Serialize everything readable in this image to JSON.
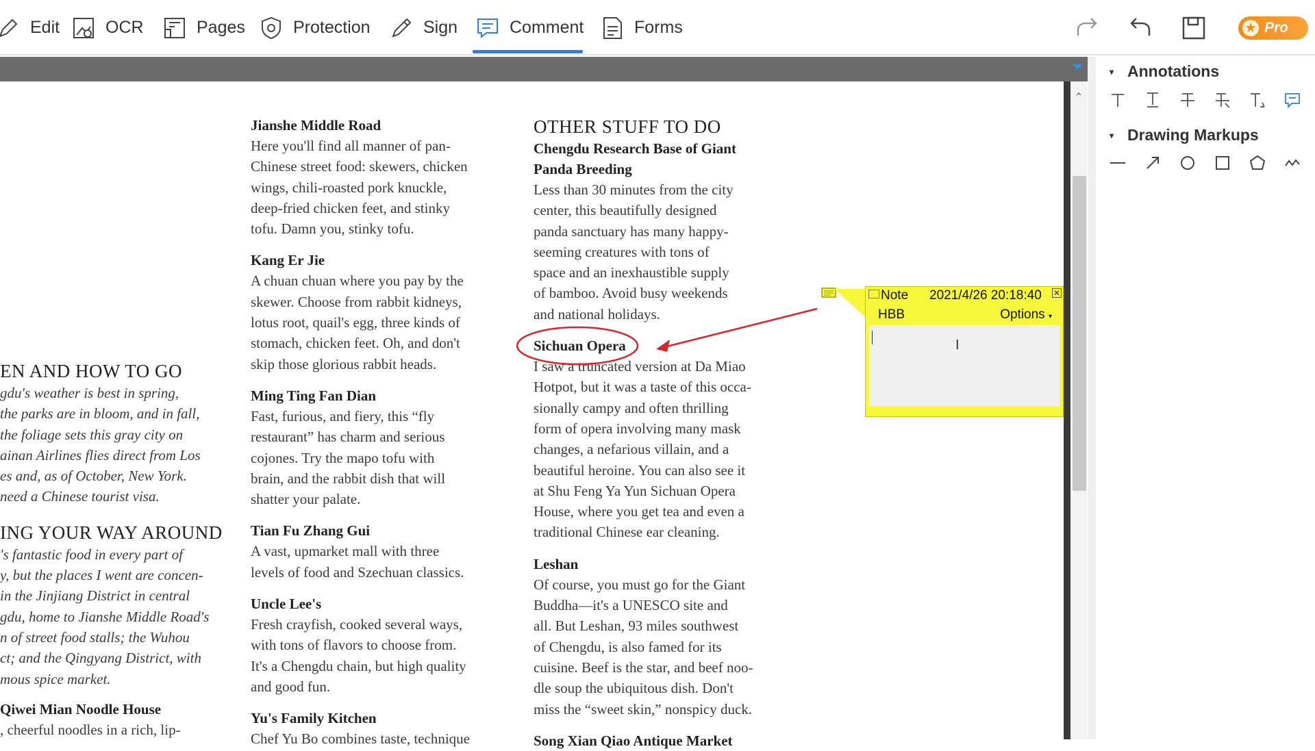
{
  "toolbar": {
    "items": [
      {
        "label": "Edit"
      },
      {
        "label": "OCR"
      },
      {
        "label": "Pages"
      },
      {
        "label": "Protection"
      },
      {
        "label": "Sign"
      },
      {
        "label": "Comment"
      },
      {
        "label": "Forms"
      }
    ],
    "active": "Comment",
    "pro_label": "Pro",
    "accent_color": "#2f7fe0",
    "pro_color": "#f68a18"
  },
  "document": {
    "left_column": {
      "heading1": "EN AND HOW TO GO",
      "para1": [
        "gdu's weather is best in spring,",
        "the parks are in bloom, and in fall,",
        " the foliage sets this gray city on",
        "ainan Airlines flies direct from Los",
        "es and, as of October, New York.",
        " need a Chinese tourist visa."
      ],
      "heading2": "ING YOUR WAY AROUND",
      "para2": [
        "'s fantastic food in every part of",
        "y, but the places I went are concen-",
        " in the Jinjiang District in central",
        "gdu, home to Jianshe Middle Road's",
        "n of street food stalls; the Wuhou",
        "ct; and the Qingyang District, with",
        "mous spice market."
      ],
      "heading3": " Qiwei Mian Noodle House",
      "para3": [
        ", cheerful noodles in a rich, lip-"
      ]
    },
    "middle_column": [
      {
        "title": "Jianshe Middle Road",
        "lines": [
          "Here you'll find all manner of pan-",
          "Chinese street food: skewers, chicken",
          "wings, chili-roasted pork knuckle,",
          "deep-fried chicken feet, and stinky",
          "tofu. Damn you, stinky tofu."
        ]
      },
      {
        "title": "Kang Er Jie",
        "lines": [
          "A chuan chuan where you pay by the",
          "skewer. Choose from rabbit kidneys,",
          "lotus root, quail's egg, three kinds of",
          "stomach, chicken feet. Oh, and don't",
          "skip those glorious rabbit heads."
        ]
      },
      {
        "title": "Ming Ting Fan Dian",
        "lines": [
          "Fast, furious, and fiery, this “fly",
          "restaurant” has charm and serious",
          "cojones. Try the mapo tofu with",
          "brain, and the rabbit dish that will",
          "shatter your palate."
        ]
      },
      {
        "title": "Tian Fu Zhang Gui",
        "lines": [
          "A vast, upmarket mall with three",
          "levels of food and Szechuan classics."
        ]
      },
      {
        "title": "Uncle Lee's",
        "lines": [
          "Fresh crayfish, cooked several ways,",
          "with tons of flavors to choose from.",
          "It's a Chengdu chain, but high quality",
          "and good fun."
        ]
      },
      {
        "title": "Yu's Family Kitchen",
        "lines": [
          "Chef Yu Bo combines taste, technique"
        ]
      }
    ],
    "right_column": {
      "section": "OTHER STUFF TO DO",
      "entries": [
        {
          "title_lines": [
            "Chengdu Research Base of Giant",
            "Panda Breeding"
          ],
          "lines": [
            "Less than 30 minutes from the city",
            "center, this beautifully designed",
            "panda sanctuary has many happy-",
            "seeming creatures with tons of",
            "space and an inexhaustible supply",
            "of bamboo. Avoid busy weekends",
            "and national holidays."
          ]
        },
        {
          "title_lines": [
            "Sichuan Opera"
          ],
          "lines": [
            "I saw a truncated version at Da Miao",
            "Hotpot, but it was a taste of this occa-",
            "sionally campy and often thrilling",
            "form of opera involving many mask",
            "changes, a nefarious villain, and a",
            "beautiful heroine. You can also see it",
            "at Shu Feng Ya Yun Sichuan Opera",
            "House, where you get tea and even a",
            "traditional Chinese ear cleaning."
          ]
        },
        {
          "title_lines": [
            "Leshan"
          ],
          "lines": [
            "Of course, you must go for the Giant",
            "Buddha—it's a UNESCO site and",
            "all. But Leshan, 93 miles southwest",
            "of Chengdu, is also famed for its",
            "cuisine. Beef is the star, and beef noo-",
            "dle soup the ubiquitous dish. Don't",
            "miss the “sweet skin,” nonspicy duck."
          ]
        },
        {
          "title_lines": [
            "Song Xian Qiao Antique Market"
          ],
          "lines": []
        }
      ]
    },
    "markup_color": "#d9232a"
  },
  "note": {
    "type": "Note",
    "timestamp": "2021/4/26 20:18:40",
    "author": "HBB",
    "options_label": "Options",
    "close_glyph": "✕",
    "body": "",
    "color": "#f6f63a"
  },
  "panel": {
    "annotations_title": "Annotations",
    "annotation_tools": [
      "text-icon",
      "text-cursor-icon",
      "strikethrough-icon",
      "replace-text-icon",
      "insert-text-icon",
      "note-comment-icon"
    ],
    "drawing_title": "Drawing Markups",
    "drawing_tools": [
      "line-icon",
      "arrow-icon",
      "circle-icon",
      "rectangle-icon",
      "polygon-icon",
      "freehand-icon"
    ]
  }
}
